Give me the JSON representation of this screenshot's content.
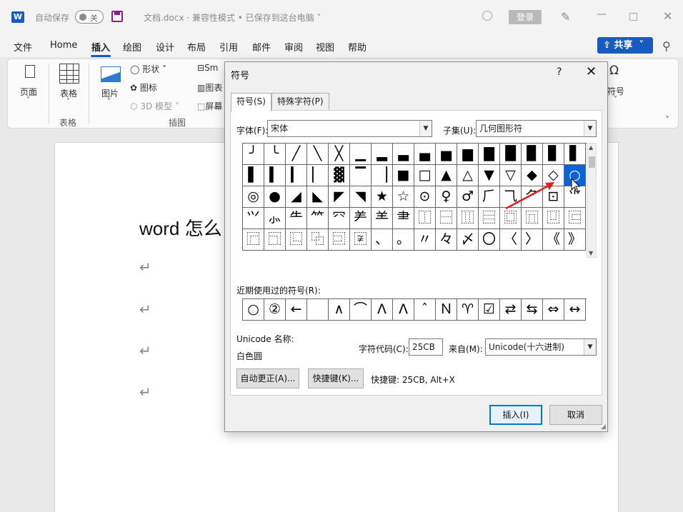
{
  "titlebar": {
    "app_icon": "word-icon",
    "autosave_label": "自动保存",
    "autosave_state": "关",
    "doc_title": "文档.docx  ·  兼容性模式 • 已保存到这台电脑 ˅",
    "login_label": "登录",
    "minimize": "—",
    "close": "✕"
  },
  "menu": {
    "items": [
      "文件",
      "Home",
      "插入",
      "绘图",
      "设计",
      "布局",
      "引用",
      "邮件",
      "审阅",
      "视图",
      "帮助"
    ],
    "active": "插入",
    "share_label": "共享"
  },
  "ribbon": {
    "page_label": "页面",
    "table_label": "表格",
    "table_group": "表格",
    "picture_label": "图片",
    "shapes_label": "形状",
    "icons_label": "图标",
    "model3d_label": "3D 模型",
    "smartart_label": "Sm",
    "chart_label": "图表",
    "screenshot_label": "屏幕",
    "illus_group": "插图",
    "symbol_label": "符号",
    "omega": "Ω"
  },
  "document": {
    "heading": "word 怎么",
    "para_mark": "↵"
  },
  "dialog": {
    "title": "符号",
    "help": "?",
    "close": "✕",
    "tabs": [
      "符号(S)",
      "特殊字符(P)"
    ],
    "font_label": "字体(F):",
    "font_value": "宋体",
    "subset_label": "子集(U):",
    "subset_value": "几何图形符",
    "symbols": [
      [
        "╯",
        "╰",
        "╱",
        "╲",
        "╳",
        "▁",
        "▂",
        "▃",
        "▄",
        "▅",
        "▆",
        "▇",
        "█",
        "▉",
        "▊",
        "▋"
      ],
      [
        "▌",
        "▍",
        "▎",
        "▏",
        "▓",
        "▔",
        "▕",
        "■",
        "□",
        "▲",
        "△",
        "▼",
        "▽",
        "◆",
        "◇",
        "○"
      ],
      [
        "◎",
        "●",
        "◢",
        "◣",
        "◤",
        "◥",
        "★",
        "☆",
        "⊙",
        "♀",
        "♂",
        "〆",
        "〇",
        "〈",
        "〉",
        "《"
      ],
      [
        "︾",
        "︽",
        "︹",
        "︺",
        "︿",
        "﹀",
        "︷",
        "︸",
        "﹁",
        "﹂",
        "﹃",
        "﹄",
        "﹇",
        "﹈",
        "︵",
        "︶"
      ],
      [
        "︻",
        "︼",
        "︴",
        "︳",
        "︱",
        "「",
        "」",
        "『",
        "』",
        "〔",
        "〕",
        "〖",
        "〗",
        "【",
        "】",
        "〃"
      ]
    ],
    "symbols_display": [
      [
        "╯",
        "╰",
        "╱",
        "╲",
        "╳",
        "▁",
        "▂",
        "▃",
        "▄",
        "▅",
        "▆",
        "▇",
        "█",
        "▉",
        "▊",
        "▋"
      ],
      [
        "▌",
        "▍",
        "▎",
        "▏",
        "▓",
        "▔",
        "▕",
        "■",
        "□",
        "▲",
        "△",
        "▼",
        "▽",
        "◆",
        "◇",
        "○"
      ],
      [
        "◎",
        "●",
        "◢",
        "◣",
        "◤",
        "◥",
        "★",
        "☆",
        "⊙",
        "♀",
        "♂",
        "⺁",
        "⺄",
        "⺈",
        "⊡",
        "⺌"
      ],
      [
        "⺍",
        "⺗",
        "⺧",
        "⺮",
        "⺳",
        "⺶",
        "⺷",
        "⺻",
        "⿰",
        "⿱",
        "⿲",
        "⿳",
        "⿴",
        "⿵",
        "⿶",
        "⿷"
      ],
      [
        "⿸",
        "⿹",
        "⿺",
        "⿻",
        "⿼",
        "〾",
        "、",
        "。",
        "〃",
        "々",
        "〆",
        "〇",
        "〈",
        "〉",
        "《",
        "》"
      ]
    ],
    "selected_row": 1,
    "selected_col": 15,
    "recent_label": "近期使用过的符号(R):",
    "recent": [
      "○",
      "②",
      "←",
      "",
      "∧",
      "⌒",
      "Λ",
      "Λ",
      "ˆ",
      "Ｎ",
      "♈",
      "☑",
      "⇄",
      "⇆",
      "⇔",
      "↔"
    ],
    "unicode_name_label": "Unicode 名称:",
    "unicode_name": "白色圆",
    "charcode_label": "字符代码(C):",
    "charcode_value": "25CB",
    "from_label": "来自(M):",
    "from_value": "Unicode(十六进制)",
    "autocorrect_label": "自动更正(A)...",
    "shortcut_btn_label": "快捷键(K)...",
    "shortcut_text": "快捷键: 25CB, Alt+X",
    "insert_label": "插入(I)",
    "cancel_label": "取消"
  },
  "colors": {
    "accent": "#185abd",
    "selection": "#0a64d6",
    "arrow": "#e02020"
  }
}
